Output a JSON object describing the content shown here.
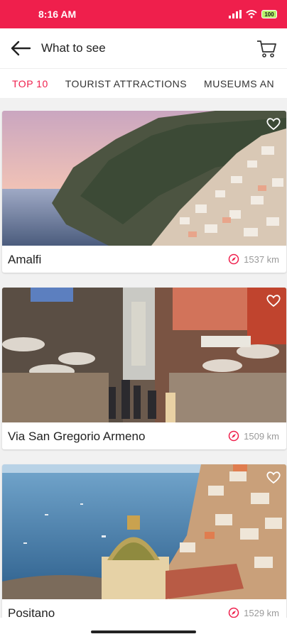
{
  "status": {
    "time": "8:16 AM",
    "battery": "100"
  },
  "header": {
    "title": "What to see"
  },
  "tabs": [
    "TOP 10",
    "TOURIST ATTRACTIONS",
    "MUSEUMS AN"
  ],
  "cards": [
    {
      "name": "Amalfi",
      "distance": "1537 km"
    },
    {
      "name": "Via San Gregorio Armeno",
      "distance": "1509 km"
    },
    {
      "name": "Positano",
      "distance": "1529 km"
    }
  ],
  "colors": {
    "accent": "#ef1f4c",
    "distance_text": "#9a9a9a"
  }
}
